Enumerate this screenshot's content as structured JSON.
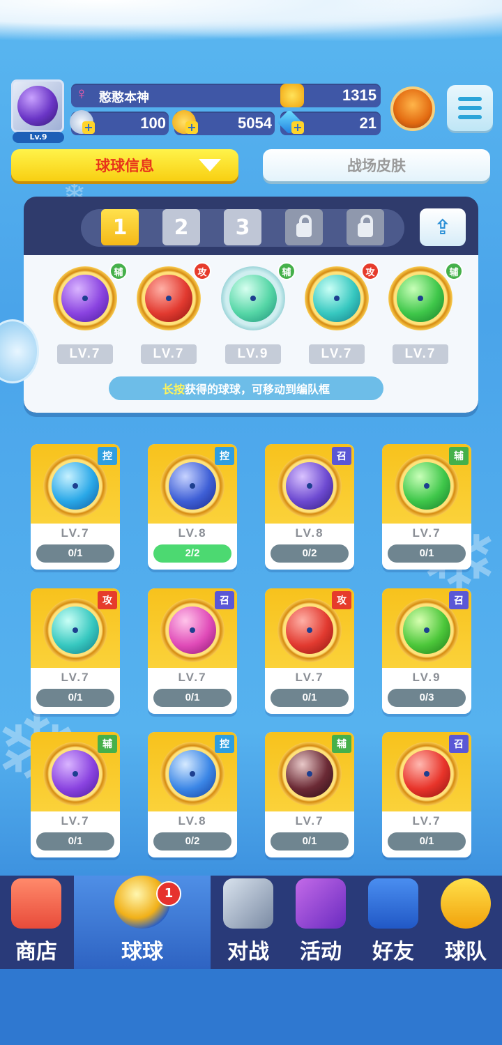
{
  "player": {
    "level": "Lv.9",
    "name": "憨憨本神",
    "trophies": "1315"
  },
  "currency": {
    "energy": "100",
    "gold": "5054",
    "gems": "21"
  },
  "tabs": {
    "ball_info": "球球信息",
    "skins": "战场皮肤"
  },
  "team": {
    "slots": [
      "1",
      "2",
      "3"
    ],
    "balls": [
      {
        "type": "辅",
        "level": "LV.7"
      },
      {
        "type": "攻",
        "level": "LV.7"
      },
      {
        "type": "辅",
        "level": "LV.9"
      },
      {
        "type": "攻",
        "level": "LV.7"
      },
      {
        "type": "辅",
        "level": "LV.7"
      }
    ],
    "hint_em": "长按",
    "hint_rest": "获得的球球，可移动到编队框"
  },
  "collection": [
    {
      "type": "控",
      "level": "LV.7",
      "count": "0/1"
    },
    {
      "type": "控",
      "level": "LV.8",
      "count": "2/2"
    },
    {
      "type": "召",
      "level": "LV.8",
      "count": "0/2"
    },
    {
      "type": "辅",
      "level": "LV.7",
      "count": "0/1"
    },
    {
      "type": "攻",
      "level": "LV.7",
      "count": "0/1"
    },
    {
      "type": "召",
      "level": "LV.7",
      "count": "0/1"
    },
    {
      "type": "攻",
      "level": "LV.7",
      "count": "0/1"
    },
    {
      "type": "召",
      "level": "LV.9",
      "count": "0/3"
    },
    {
      "type": "辅",
      "level": "LV.7",
      "count": "0/1"
    },
    {
      "type": "控",
      "level": "LV.8",
      "count": "0/2"
    },
    {
      "type": "辅",
      "level": "LV.7",
      "count": "0/1"
    },
    {
      "type": "召",
      "level": "LV.7",
      "count": "0/1"
    }
  ],
  "nav": {
    "shop": "商店",
    "balls": "球球",
    "battle": "对战",
    "events": "活动",
    "friends": "好友",
    "team": "球队",
    "balls_badge": "1"
  },
  "colors": {
    "accent_yellow": "#f8cf12",
    "attack_red": "#e63b2b",
    "support_green": "#45b04a",
    "control_blue": "#2e9ee0",
    "summon_purple": "#5a57d6"
  }
}
